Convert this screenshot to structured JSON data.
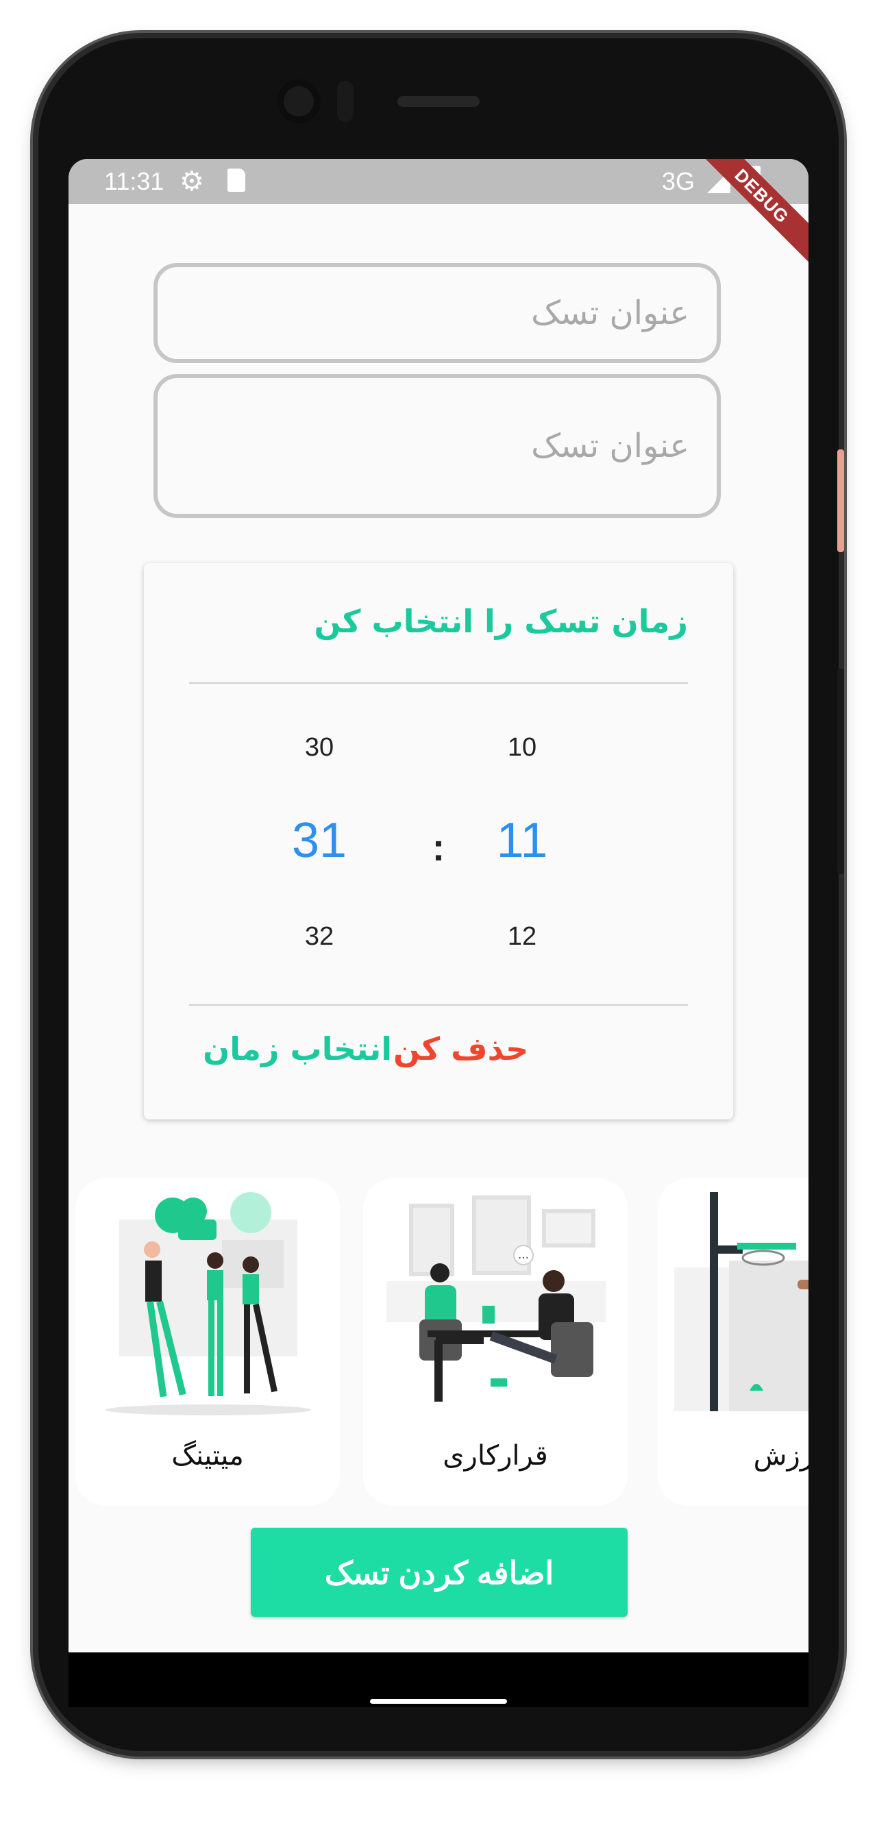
{
  "status_bar": {
    "time": "11:31",
    "network": "3G",
    "icons": [
      "gear-icon",
      "sd-card-icon",
      "signal-icon",
      "battery-icon"
    ]
  },
  "debug_banner": "DEBUG",
  "form": {
    "title_placeholder": "عنوان تسک",
    "description_placeholder": "عنوان تسک"
  },
  "time_picker": {
    "title": "زمان تسک را انتخاب کن",
    "hour": {
      "above": "10",
      "selected": "11",
      "below": "12"
    },
    "minute": {
      "above": "30",
      "selected": "31",
      "below": "32"
    },
    "separator": ":",
    "select_label": "انتخاب زمان",
    "delete_label": "حذف کن",
    "accent_color": "#1bc99c",
    "selected_color": "#2d8ff0",
    "delete_color": "#f0452f"
  },
  "categories": [
    {
      "label": "میتینگ",
      "icon": "meeting-illustration"
    },
    {
      "label": "قرارکاری",
      "icon": "business-meeting-illustration"
    },
    {
      "label": "ورزش",
      "icon": "sport-basketball-illustration"
    }
  ],
  "add_button": {
    "label": "اضافه کردن تسک",
    "color": "#1ddca4"
  }
}
